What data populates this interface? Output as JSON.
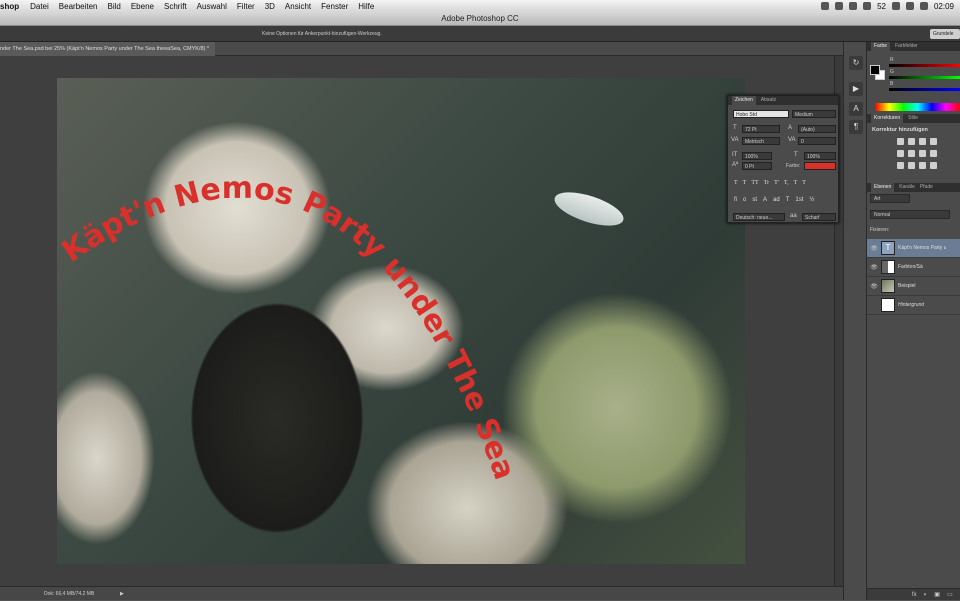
{
  "menubar": {
    "app": "shop",
    "items": [
      "Datei",
      "Bearbeiten",
      "Bild",
      "Ebene",
      "Schrift",
      "Auswahl",
      "Filter",
      "3D",
      "Ansicht",
      "Fenster",
      "Hilfe"
    ],
    "battery": "52",
    "time": "02:09"
  },
  "window": {
    "title": "Adobe Photoshop CC"
  },
  "options_bar": {
    "message": "Keine Optionen für Ankerpunkt-hinzufügen-Werkzeug.",
    "workspace": "Grundele"
  },
  "document": {
    "tab_title": "nder The Sea.psd bei 25% (Käpt'n Nemos Party under The Sea theeaSea, CMYK/8) *",
    "curved_text": "Käpt'n Nemos Party under The Sea",
    "curved_text_color": "#d9302b"
  },
  "status_bar": {
    "doc_size": "Dok: 66,4 MB/74,2 MB",
    "arrow": "▶"
  },
  "color_panel": {
    "tabs": [
      "Farbe",
      "Farbfelder"
    ],
    "channels": [
      "R",
      "G",
      "B"
    ]
  },
  "adjustments_panel": {
    "tabs": [
      "Korrekturen",
      "Stile"
    ],
    "title": "Korrektur hinzufügen"
  },
  "layers_panel": {
    "tabs": [
      "Ebenen",
      "Kanäle",
      "Pfade"
    ],
    "filter": "Art",
    "blend_mode": "Normal",
    "lock_label": "Fixieren:",
    "layers": [
      {
        "name": "Käpt'n Nemos Party u",
        "kind": "T",
        "visible": "👁",
        "selected": true
      },
      {
        "name": "Farbton/Sä",
        "kind": "adj",
        "visible": "👁",
        "selected": false
      },
      {
        "name": "Beispiel",
        "kind": "img",
        "visible": "👁",
        "selected": false
      },
      {
        "name": "Hintergrund",
        "kind": "bg",
        "visible": "",
        "selected": false
      }
    ],
    "footer_icons": [
      "fx",
      "◐",
      "▣",
      "▭",
      "🗑"
    ]
  },
  "character_panel": {
    "tabs": [
      "Zeichen",
      "Absatz"
    ],
    "font_family": "Hobo Std",
    "font_style": "Medium",
    "font_size": "72 Pt",
    "leading": "(Auto)",
    "kerning": "Metrisch",
    "tracking": "0",
    "vertical_scale": "100%",
    "horizontal_scale": "100%",
    "baseline_shift": "0 Pt",
    "color_label": "Farbe:",
    "language": "Deutsch: neue...",
    "antialias": "Scharf",
    "type_buttons": [
      "T",
      "T",
      "TT",
      "Tr",
      "T'",
      "T,",
      "T",
      "T"
    ],
    "ot_buttons": [
      "fi",
      "o",
      "st",
      "A",
      "ad",
      "T",
      "1st",
      "½"
    ]
  }
}
